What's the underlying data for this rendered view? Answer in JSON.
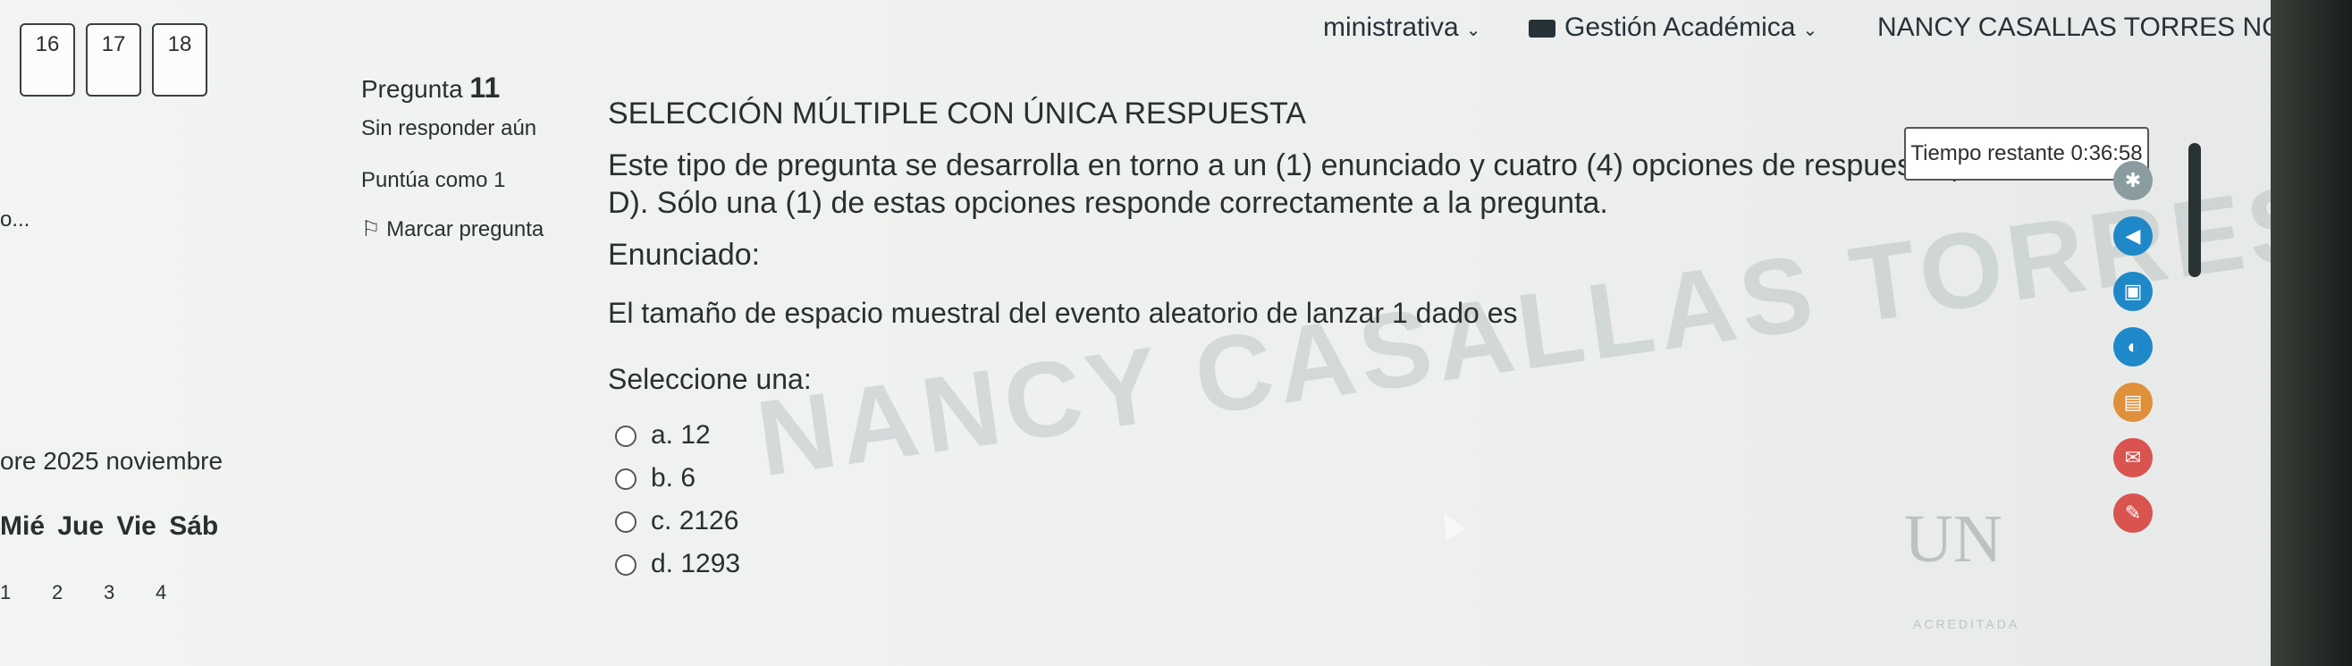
{
  "topbar": {
    "admin_label": "ministrativa",
    "academic_label": "Gestión Académica",
    "user_name": "NANCY CASALLAS TORRES",
    "user_initials": "NC"
  },
  "nav_numbers": [
    "16",
    "17",
    "18"
  ],
  "left": {
    "truncated": "o...",
    "calendar_title": "ore 2025  noviembre",
    "weekdays": "Mié  Jue  Vie  Sáb",
    "days": [
      "1",
      "2",
      "3",
      "4"
    ]
  },
  "question_info": {
    "title_prefix": "Pregunta",
    "number": "11",
    "status": "Sin responder aún",
    "points": "Puntúa como 1",
    "flag_label": "Marcar pregunta"
  },
  "question": {
    "heading": "SELECCIÓN MÚLTIPLE CON ÚNICA RESPUESTA",
    "description": "Este tipo de pregunta se desarrolla en torno a un (1) enunciado y cuatro (4) opciones de respuesta (A, B, C, D). Sólo una (1) de estas opciones responde correctamente a la pregunta.",
    "enunciado_label": "Enunciado:",
    "statement": "El tamaño de espacio muestral del evento aleatorio de lanzar 1 dado es",
    "select_label": "Seleccione una:",
    "options": [
      {
        "letter": "a.",
        "value": "12"
      },
      {
        "letter": "b.",
        "value": "6"
      },
      {
        "letter": "c.",
        "value": "2126"
      },
      {
        "letter": "d.",
        "value": "1293"
      }
    ]
  },
  "timer": "Tiempo restante 0:36:58",
  "watermark": "NANCY CASALLAS TORRES",
  "logo": "UN",
  "logo_sub": "ACREDITADA",
  "rail_icons": [
    {
      "name": "accessibility-icon",
      "color": "#8a9ca0"
    },
    {
      "name": "audio-icon",
      "color": "#1f88c9"
    },
    {
      "name": "image-icon",
      "color": "#1f88c9"
    },
    {
      "name": "moon-icon",
      "color": "#1f88c9"
    },
    {
      "name": "book-icon",
      "color": "#e0903a"
    },
    {
      "name": "mail-icon",
      "color": "#d9534f"
    },
    {
      "name": "chat-icon",
      "color": "#d9534f"
    }
  ]
}
